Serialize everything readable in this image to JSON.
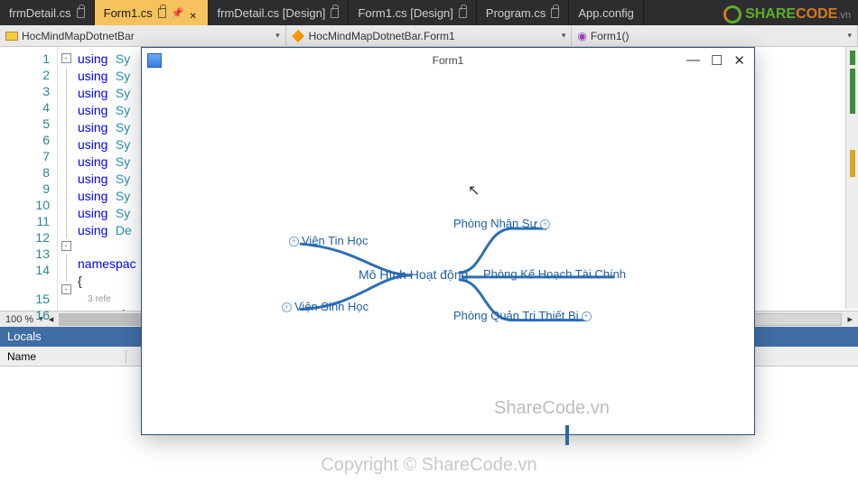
{
  "tabs": [
    {
      "label": "frmDetail.cs"
    },
    {
      "label": "Form1.cs"
    },
    {
      "label": "frmDetail.cs [Design]"
    },
    {
      "label": "Form1.cs [Design]"
    },
    {
      "label": "Program.cs"
    },
    {
      "label": "App.config"
    }
  ],
  "nav": {
    "namespace": "HocMindMapDotnetBar",
    "class": "HocMindMapDotnetBar.Form1",
    "member": "Form1()"
  },
  "gutter": [
    "1",
    "2",
    "3",
    "4",
    "5",
    "6",
    "7",
    "8",
    "9",
    "10",
    "11",
    "12",
    "13",
    "14",
    "",
    "15",
    "16"
  ],
  "code": {
    "l1": "using",
    "l1b": "Sy",
    "ns": "namespac",
    "brace_open": "{",
    "refs": "3 refe",
    "pub": "pub",
    "brace_open2": "{"
  },
  "zoom": "100 %",
  "locals": {
    "title": "Locals",
    "col1": "Name"
  },
  "form1": {
    "title": "Form1",
    "center": "Mô Hình Hoạt động",
    "left1": "Viện Tin Học",
    "left2": "Viện Sinh Học",
    "right1": "Phòng Nhân Sự",
    "right2": "Phòng Kế Hoạch Tài Chính",
    "right3": "Phòng Quản Trị Thiết Bị",
    "watermark": "ShareCode.vn"
  },
  "logo": {
    "p1": "SHARE",
    "p2": "CODE",
    "suffix": ".vn"
  },
  "copyright": "Copyright © ShareCode.vn"
}
